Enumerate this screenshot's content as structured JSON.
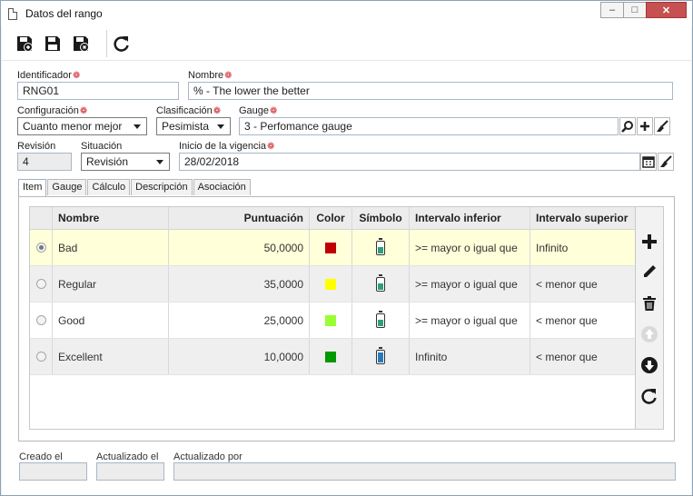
{
  "window": {
    "title": "Datos del rango"
  },
  "fields": {
    "identificador": {
      "label": "Identificador",
      "value": "RNG01"
    },
    "nombre": {
      "label": "Nombre",
      "value": "% - The lower the better"
    },
    "configuracion": {
      "label": "Configuración",
      "value": "Cuanto menor mejor"
    },
    "clasificacion": {
      "label": "Clasificación",
      "value": "Pesimista"
    },
    "gauge": {
      "label": "Gauge",
      "value": "3 - Perfomance gauge"
    },
    "revision": {
      "label": "Revisión",
      "value": "4"
    },
    "situacion": {
      "label": "Situación",
      "value": "Revisión"
    },
    "inicio": {
      "label": "Inicio de la vigencia",
      "value": "28/02/2018"
    }
  },
  "tabs": [
    "Item",
    "Gauge",
    "Cálculo",
    "Descripción",
    "Asociación"
  ],
  "grid": {
    "headers": [
      "Nombre",
      "Puntuación",
      "Color",
      "Símbolo",
      "Intervalo inferior",
      "Intervalo superior"
    ],
    "rows": [
      {
        "nombre": "Bad",
        "puntuacion": "50,0000",
        "color": "#c00000",
        "battery_color": "#2e9e7e",
        "inferior": ">= mayor o igual que",
        "superior": "Infinito",
        "selected": true
      },
      {
        "nombre": "Regular",
        "puntuacion": "35,0000",
        "color": "#ffff00",
        "battery_color": "#2e9e7e",
        "inferior": ">= mayor o igual que",
        "superior": "< menor que",
        "selected": false
      },
      {
        "nombre": "Good",
        "puntuacion": "25,0000",
        "color": "#99ff33",
        "battery_color": "#2e9e7e",
        "inferior": ">= mayor o igual que",
        "superior": "< menor que",
        "selected": false
      },
      {
        "nombre": "Excellent",
        "puntuacion": "10,0000",
        "color": "#009900",
        "battery_color": "#2a7ab8",
        "inferior": "Infinito",
        "superior": "< menor que",
        "selected": false
      }
    ]
  },
  "footer": {
    "creado": {
      "label": "Creado el",
      "value": ""
    },
    "actualizado": {
      "label": "Actualizado el",
      "value": ""
    },
    "actualizado_por": {
      "label": "Actualizado por",
      "value": ""
    }
  },
  "colors": {
    "selected_row": "#ffffd9",
    "alt_row": "#efefef"
  }
}
